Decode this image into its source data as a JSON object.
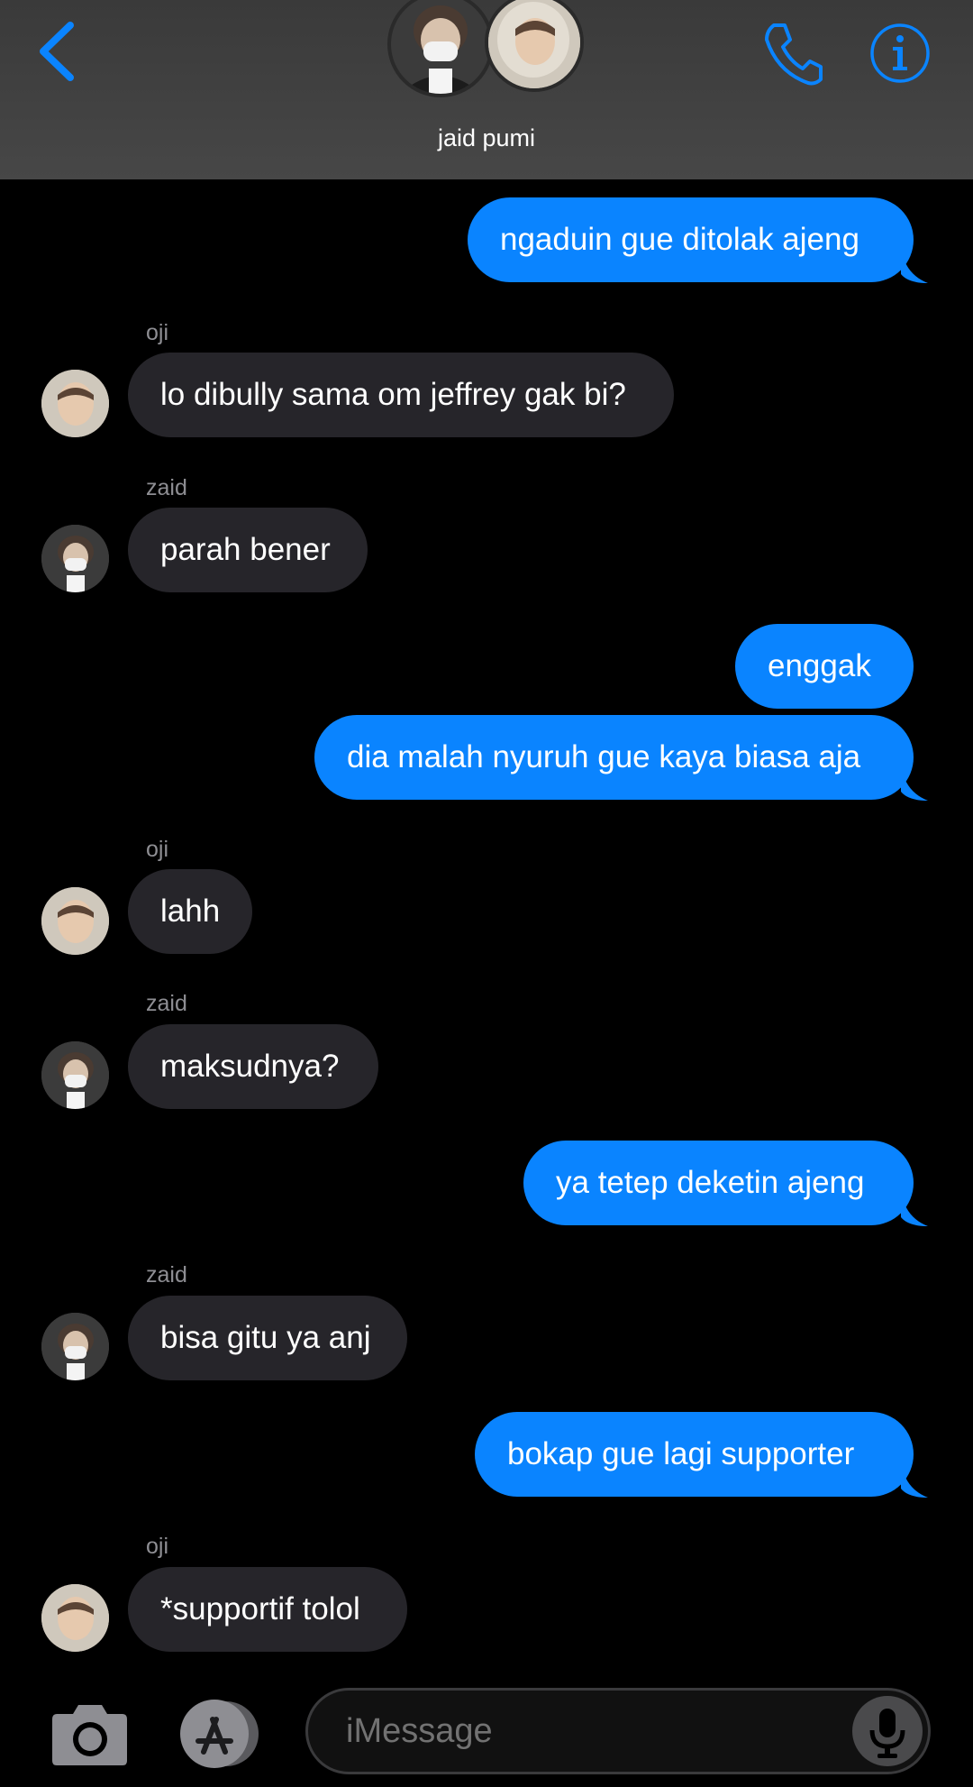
{
  "header": {
    "contact_name": "jaid pumi"
  },
  "colors": {
    "accent": "#0a84ff",
    "received_bubble": "#26252a",
    "header_bg": "#444444"
  },
  "icons": [
    "chevron-left-icon",
    "phone-icon",
    "info-icon",
    "camera-icon",
    "app-store-icon",
    "microphone-icon"
  ],
  "messages": [
    {
      "side": "sent",
      "text": "ngaduin gue ditolak ajeng"
    },
    {
      "side": "received",
      "sender": "oji",
      "text": "lo dibully sama om jeffrey gak bi?"
    },
    {
      "side": "received",
      "sender": "zaid",
      "text": "parah bener"
    },
    {
      "side": "sent",
      "text": "enggak"
    },
    {
      "side": "sent",
      "text": "dia malah nyuruh gue kaya biasa aja"
    },
    {
      "side": "received",
      "sender": "oji",
      "text": "lahh"
    },
    {
      "side": "received",
      "sender": "zaid",
      "text": "maksudnya?"
    },
    {
      "side": "sent",
      "text": "ya tetep deketin ajeng"
    },
    {
      "side": "received",
      "sender": "zaid",
      "text": "bisa gitu ya anj"
    },
    {
      "side": "sent",
      "text": "bokap gue lagi supporter"
    },
    {
      "side": "received",
      "sender": "oji",
      "text": "*supportif tolol"
    }
  ],
  "input": {
    "placeholder": "iMessage"
  }
}
